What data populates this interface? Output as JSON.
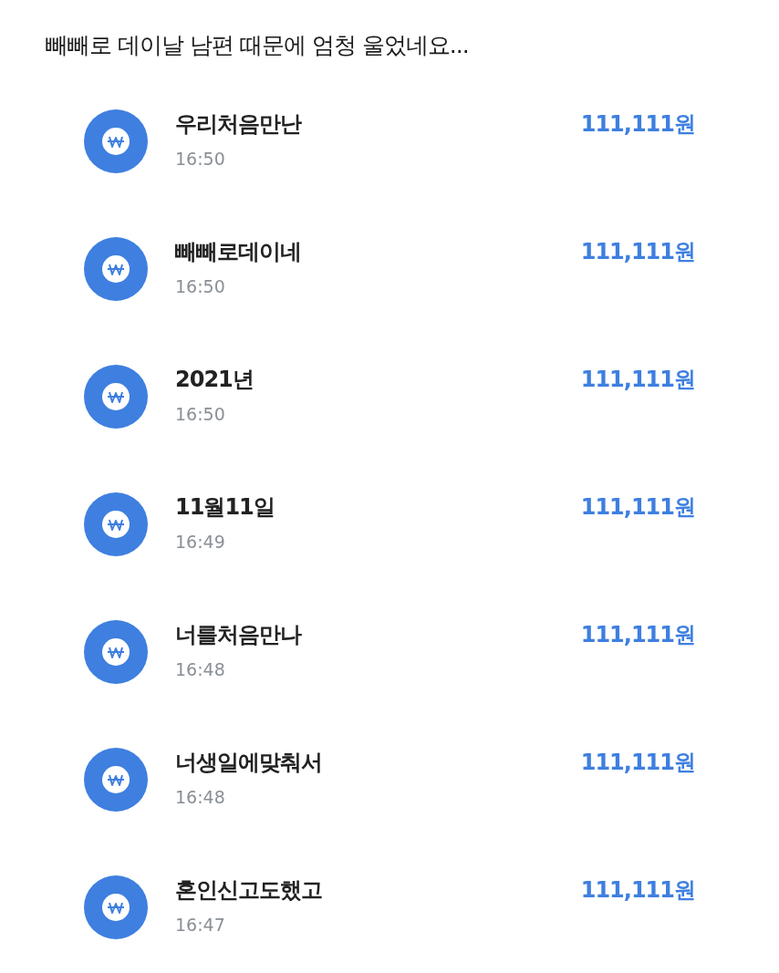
{
  "title": "빼빼로 데이날 남편 때문에 엄청 울었네요...",
  "transactions": [
    {
      "name": "우리처음만난",
      "time": "16:50",
      "amount": "111,111원"
    },
    {
      "name": "빼빼로데이네",
      "time": "16:50",
      "amount": "111,111원"
    },
    {
      "name": "2021년",
      "time": "16:50",
      "amount": "111,111원"
    },
    {
      "name": "11월11일",
      "time": "16:49",
      "amount": "111,111원"
    },
    {
      "name": "너를처음만나",
      "time": "16:48",
      "amount": "111,111원"
    },
    {
      "name": "너생일에맞춰서",
      "time": "16:48",
      "amount": "111,111원"
    },
    {
      "name": "혼인신고도했고",
      "time": "16:47",
      "amount": "111,111원"
    }
  ]
}
